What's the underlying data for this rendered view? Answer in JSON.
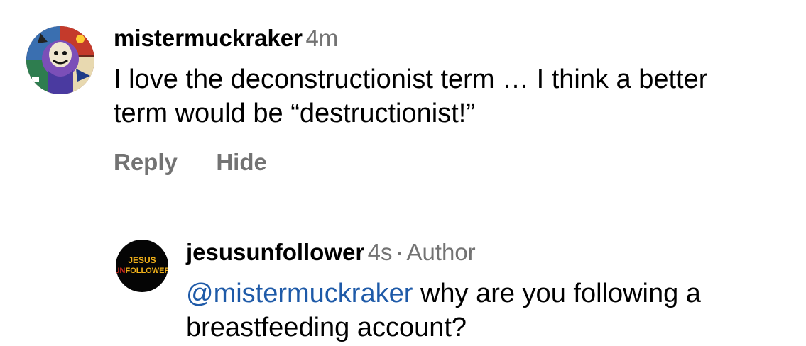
{
  "comment": {
    "username": "mistermuckraker",
    "time": "4m",
    "text": "I love the deconstructionist term … I think a better term would be “destructionist!”",
    "avatar_icon": "illustrated-character-avatar"
  },
  "actions": {
    "reply_label": "Reply",
    "hide_label": "Hide"
  },
  "reply": {
    "username": "jesusunfollower",
    "time": "4s",
    "separator": "·",
    "badge": "Author",
    "mention": "@mistermuckraker",
    "text": " why are you following a breastfeeding account?",
    "avatar": {
      "line1": "JESUS",
      "line2_prefix": "UN",
      "line2_rest": "FOLLOWER"
    }
  },
  "colors": {
    "secondary_text": "#737373",
    "mention_link": "#1e5aa8",
    "avatar_accent": "#f2b21a",
    "avatar_red": "#d8281e"
  }
}
